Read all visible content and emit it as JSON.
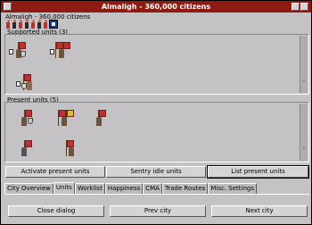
{
  "window": {
    "title": "Almaligh - 360,000 citizens"
  },
  "city": {
    "citizens_label": "Almaligh - 360,000 citizens",
    "citizens": [
      "happy",
      "content",
      "content",
      "unhappy",
      "unhappy",
      "angry",
      "specialist",
      "specialist"
    ]
  },
  "supported": {
    "label": "Supported units (3)"
  },
  "present": {
    "label": "Present units (5)"
  },
  "actions": {
    "activate": "Activate present units",
    "sentry": "Sentry idle units",
    "list": "List present units"
  },
  "tabs": [
    "City Overview",
    "Units",
    "Worklist",
    "Happiness",
    "CMA",
    "Trade Routes",
    "Misc. Settings"
  ],
  "active_tab": "Units",
  "footer": {
    "close": "Close dialog",
    "prev": "Prev city",
    "next": "Next city"
  },
  "colors": {
    "titlebar": "#8e1a12",
    "unit_flag": "#c03030"
  }
}
